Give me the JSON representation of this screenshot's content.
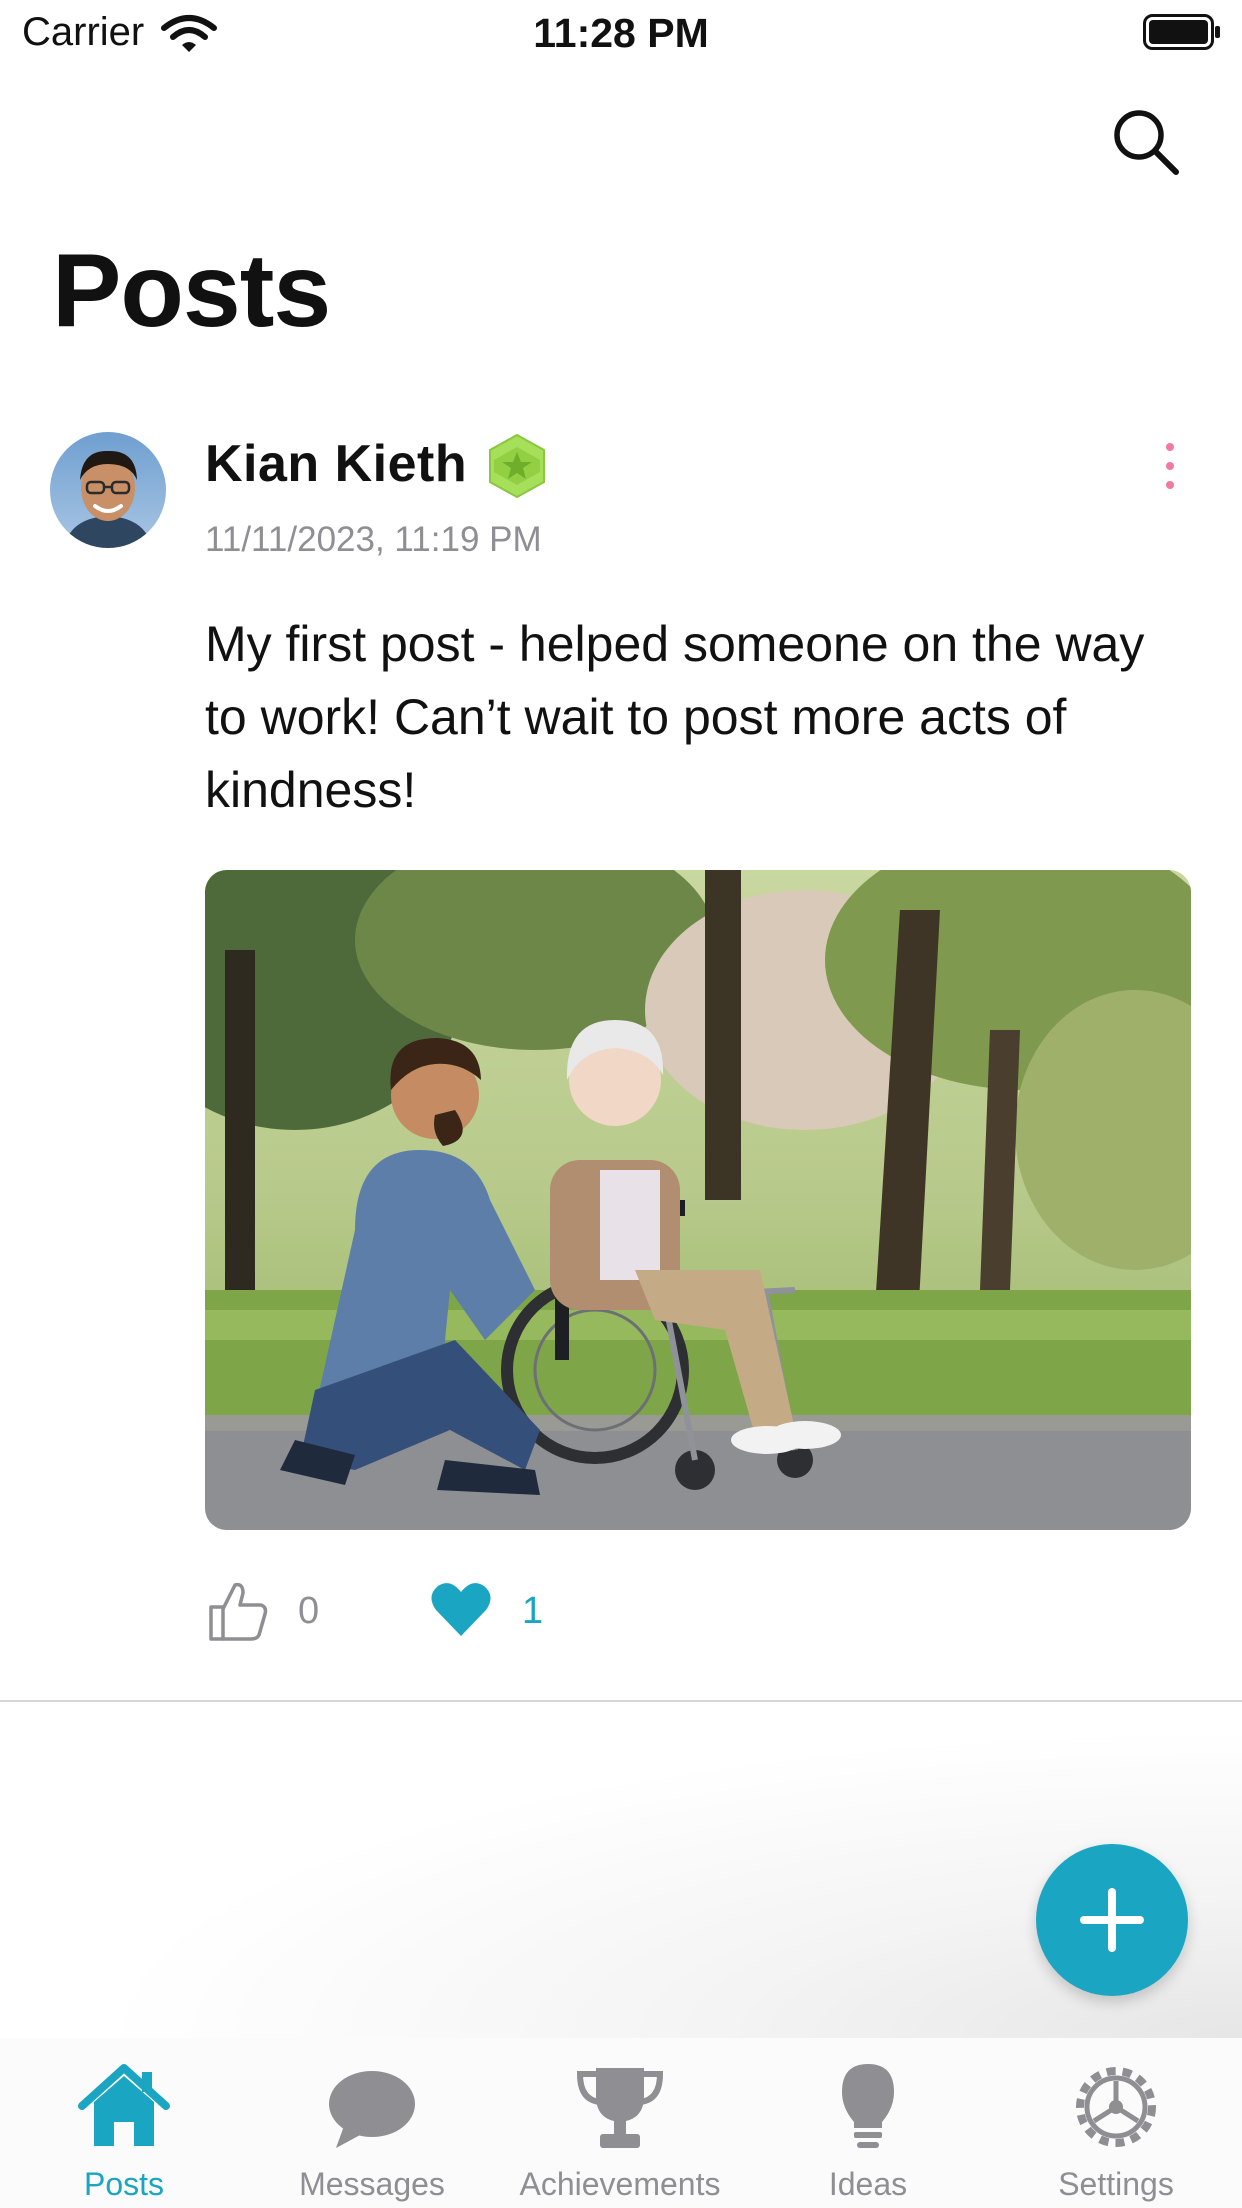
{
  "status_bar": {
    "carrier": "Carrier",
    "time": "11:28 PM"
  },
  "header": {
    "title": "Posts",
    "search_icon": "search-icon"
  },
  "post": {
    "author": "Kian Kieth",
    "badge_icon": "star-hexagon-badge-icon",
    "timestamp": "11/11/2023, 11:19 PM",
    "text": "My first post - helped someone on the way to work! Can’t wait to post more acts of kindness!",
    "like_count": "0",
    "heart_count": "1",
    "more_icon": "more-vertical-icon"
  },
  "colors": {
    "accent": "#1aa6c2",
    "badge": "#a6e05a",
    "more_dots": "#f07aa0",
    "secondary_text": "#8e8e93"
  },
  "fab": {
    "icon": "plus-icon"
  },
  "tabs": [
    {
      "label": "Posts",
      "icon": "home-icon",
      "active": true
    },
    {
      "label": "Messages",
      "icon": "chat-bubble-icon",
      "active": false
    },
    {
      "label": "Achievements",
      "icon": "trophy-icon",
      "active": false
    },
    {
      "label": "Ideas",
      "icon": "lightbulb-icon",
      "active": false
    },
    {
      "label": "Settings",
      "icon": "gear-icon",
      "active": false
    }
  ]
}
